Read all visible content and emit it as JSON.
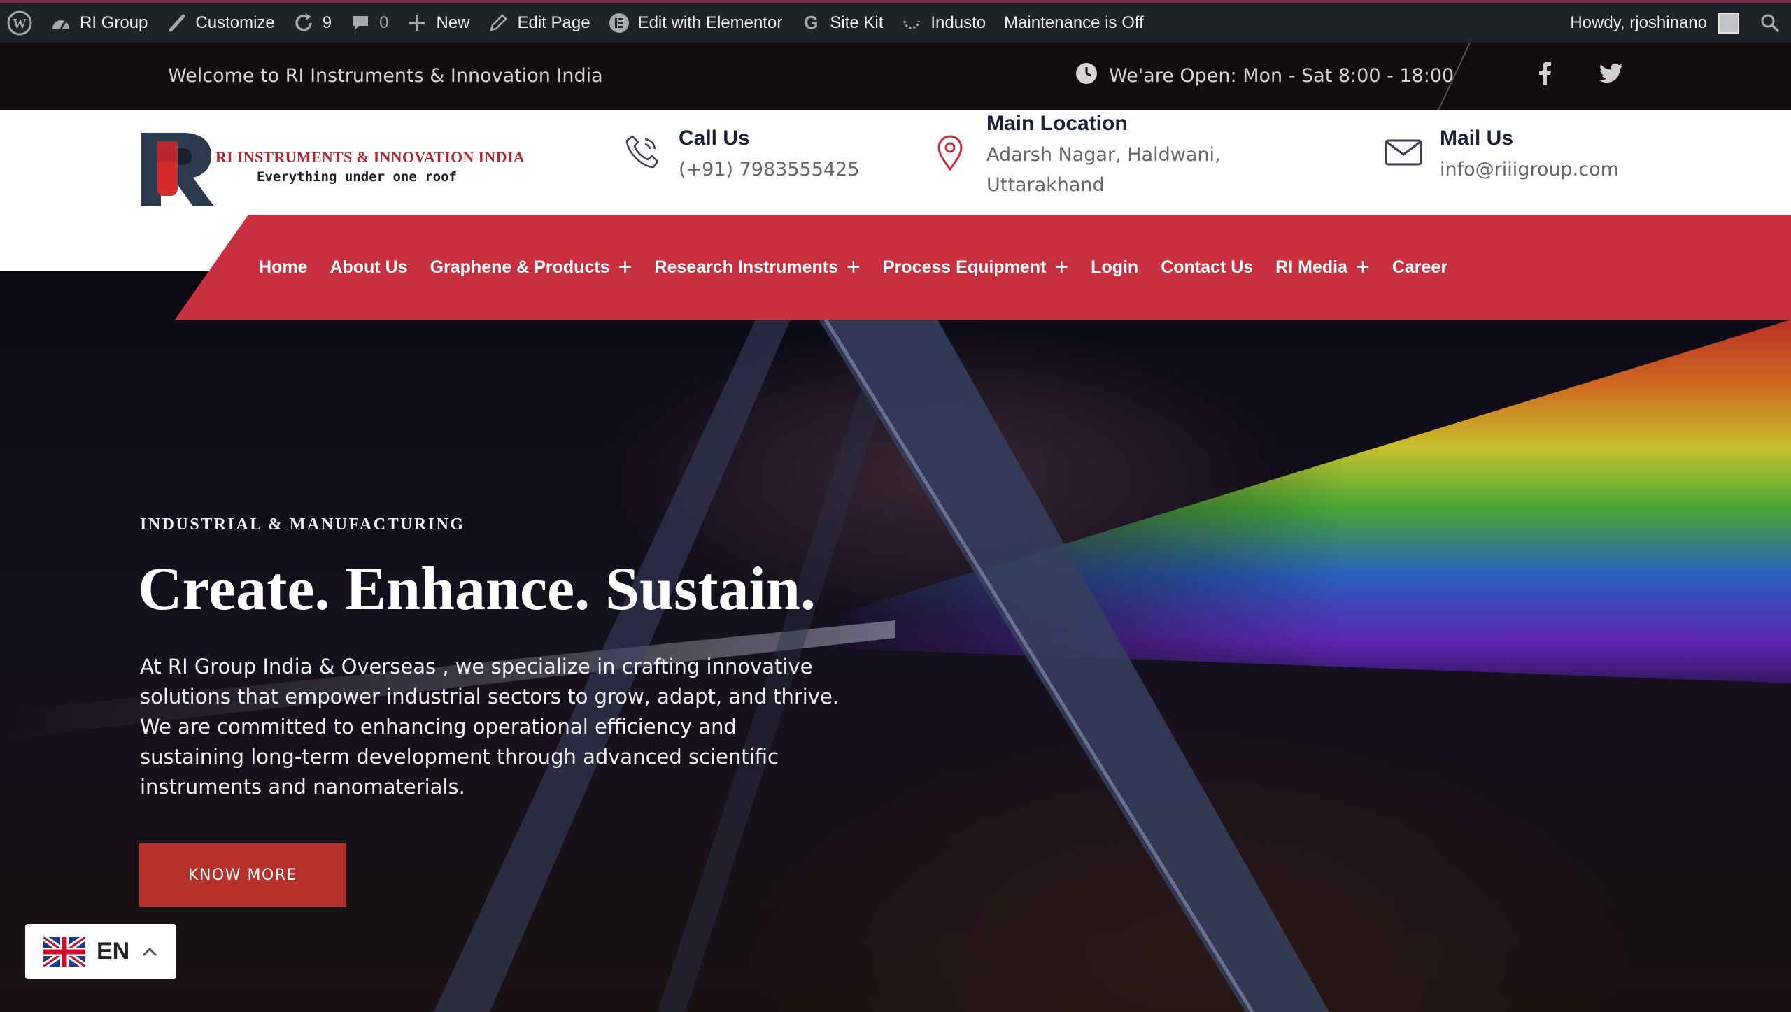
{
  "adminbar": {
    "site": "RI Group",
    "customize": "Customize",
    "updates_count": "9",
    "comments_count": "0",
    "new": "New",
    "edit_page": "Edit Page",
    "elementor": "Edit with Elementor",
    "sitekit": "Site Kit",
    "theme": "Industo",
    "maintenance": "Maintenance is Off",
    "howdy": "Howdy, rjoshinano"
  },
  "topbar": {
    "welcome": "Welcome to RI Instruments & Innovation India",
    "hours": "We'are Open: Mon - Sat 8:00 - 18:00"
  },
  "logo": {
    "title": "RI INSTRUMENTS & INNOVATION INDIA",
    "tagline": "Everything under one roof"
  },
  "contacts": {
    "call": {
      "title": "Call Us",
      "lines": [
        "(+91) 7983555425"
      ]
    },
    "location": {
      "title": "Main Location",
      "lines": [
        "Adarsh Nagar, Haldwani,",
        "Uttarakhand"
      ]
    },
    "mail": {
      "title": "Mail Us",
      "lines": [
        "info@riiigroup.com"
      ]
    }
  },
  "nav": {
    "items": [
      {
        "label": "Home",
        "dropdown": false
      },
      {
        "label": "About Us",
        "dropdown": false
      },
      {
        "label": "Graphene & Products",
        "dropdown": true
      },
      {
        "label": "Research Instruments",
        "dropdown": true
      },
      {
        "label": "Process Equipment",
        "dropdown": true
      },
      {
        "label": "Login",
        "dropdown": false
      },
      {
        "label": "Contact Us",
        "dropdown": false
      },
      {
        "label": "RI Media",
        "dropdown": true
      },
      {
        "label": "Career",
        "dropdown": false
      }
    ],
    "plus": "+"
  },
  "hero": {
    "kicker": "INDUSTRIAL & MANUFACTURING",
    "headline": "Create. Enhance. Sustain.",
    "paragraph": "At RI Group India & Overseas , we specialize in crafting innovative solutions that empower industrial sectors to grow, adapt, and thrive. We are committed to enhancing operational efficiency and sustaining long-term development through advanced scientific instruments and nanomaterials.",
    "cta": "KNOW MORE"
  },
  "language": {
    "code": "EN"
  },
  "colors": {
    "brand_red": "#c8303f",
    "cta_red": "#b8302a",
    "adminbar": "#1d2327",
    "topbar": "#120c0c"
  }
}
